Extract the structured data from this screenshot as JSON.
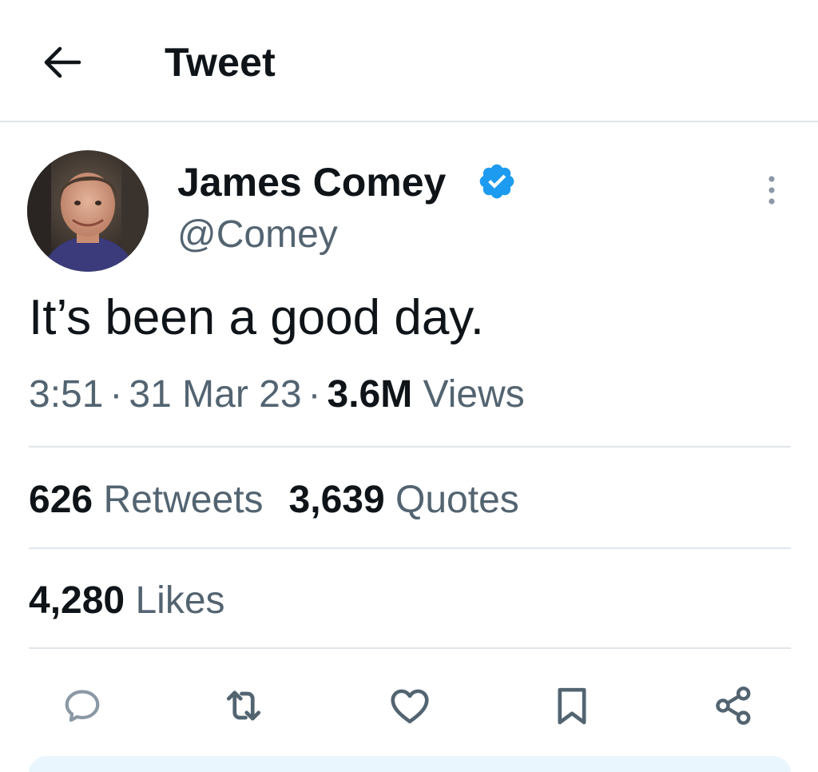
{
  "header": {
    "title": "Tweet",
    "back_icon": "arrow-left-icon"
  },
  "author": {
    "name": "James Comey",
    "handle": "@Comey",
    "verified_icon": "verified-badge-icon",
    "verified_color": "#1d9bf0",
    "more_icon": "more-vertical-icon"
  },
  "tweet": {
    "text": "It’s been a good day.",
    "time": "3:51",
    "date": "31 Mar 23",
    "views_count": "3.6M",
    "views_label": "Views",
    "separator": "·"
  },
  "stats": {
    "retweets_count": "626",
    "retweets_label": "Retweets",
    "quotes_count": "3,639",
    "quotes_label": "Quotes",
    "likes_count": "4,280",
    "likes_label": "Likes"
  },
  "actions": {
    "reply_icon": "reply-icon",
    "retweet_icon": "retweet-icon",
    "like_icon": "heart-icon",
    "bookmark_icon": "bookmark-icon",
    "share_icon": "share-icon",
    "icon_color": "#536471"
  },
  "colors": {
    "text_primary": "#0f1419",
    "text_secondary": "#536471",
    "divider": "#e1e6ea",
    "composer_bg": "#eaf6fe"
  }
}
